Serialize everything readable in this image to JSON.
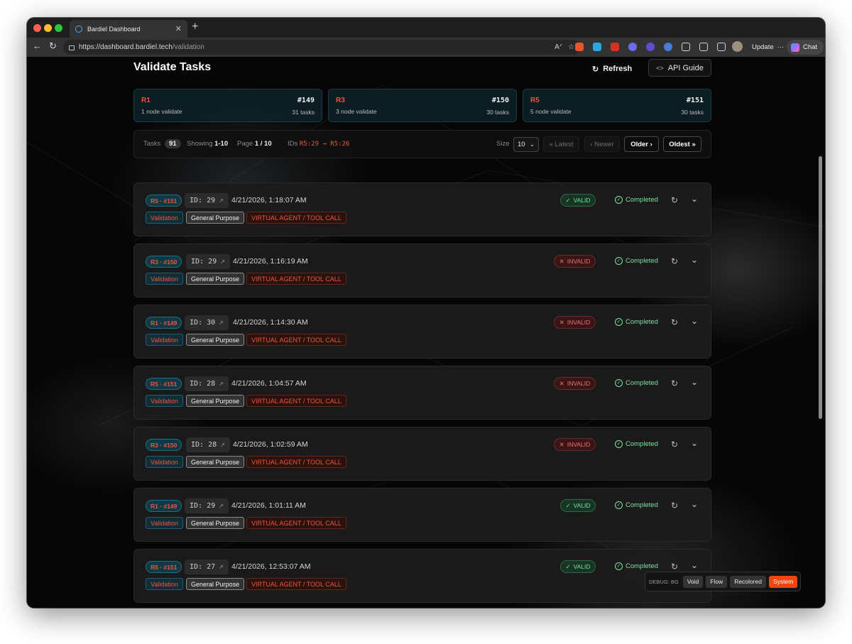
{
  "browser": {
    "tab_title": "Bardiel Dashboard",
    "url_host": "https://dashboard.bardiel.tech",
    "url_path": "/validation",
    "update_label": "Update",
    "chat_label": "Chat"
  },
  "header": {
    "title": "Validate Tasks",
    "refresh_label": "Refresh",
    "api_guide_label": "API Guide"
  },
  "rounds": [
    {
      "name": "R1",
      "number": "#149",
      "desc": "1 node validate",
      "tasks": "31 tasks"
    },
    {
      "name": "R3",
      "number": "#150",
      "desc": "3 node validate",
      "tasks": "30 tasks"
    },
    {
      "name": "R5",
      "number": "#151",
      "desc": "5 node validate",
      "tasks": "30 tasks"
    }
  ],
  "stats": {
    "tasks_label": "Tasks",
    "tasks_count": "91",
    "showing_label": "Showing",
    "showing_value": "1-10",
    "page_label": "Page",
    "page_value": "1 / 10",
    "ids_label": "IDs",
    "ids_value": "R5:29 → R5:26",
    "size_label": "Size",
    "size_value": "10",
    "latest_label": "« Latest",
    "newer_label": "‹ Newer",
    "older_label": "Older ›",
    "oldest_label": "Oldest »"
  },
  "tasks": [
    {
      "round": "R5 · #151",
      "id": "ID: 29",
      "time": "4/21/2026, 1:18:07 AM",
      "result": "VALID",
      "status": "Completed"
    },
    {
      "round": "R3 · #150",
      "id": "ID: 29",
      "time": "4/21/2026, 1:16:19 AM",
      "result": "INVALID",
      "status": "Completed"
    },
    {
      "round": "R1 · #149",
      "id": "ID: 30",
      "time": "4/21/2026, 1:14:30 AM",
      "result": "INVALID",
      "status": "Completed"
    },
    {
      "round": "R5 · #151",
      "id": "ID: 28",
      "time": "4/21/2026, 1:04:57 AM",
      "result": "INVALID",
      "status": "Completed"
    },
    {
      "round": "R3 · #150",
      "id": "ID: 28",
      "time": "4/21/2026, 1:02:59 AM",
      "result": "INVALID",
      "status": "Completed"
    },
    {
      "round": "R1 · #149",
      "id": "ID: 29",
      "time": "4/21/2026, 1:01:11 AM",
      "result": "VALID",
      "status": "Completed"
    },
    {
      "round": "R5 · #151",
      "id": "ID: 27",
      "time": "4/21/2026, 12:53:07 AM",
      "result": "VALID",
      "status": "Completed"
    }
  ],
  "tags": {
    "validation": "Validation",
    "general": "General Purpose",
    "virtual_agent": "VIRTUAL AGENT / TOOL CALL"
  },
  "debug": {
    "label": "DEBUG: BG",
    "options": [
      "Void",
      "Flow",
      "Recolored",
      "System"
    ],
    "active": "System"
  },
  "colors": {
    "accent": "#f0543b",
    "valid": "#6fe39a",
    "invalid": "#f07070",
    "debug_active": "#f2450d"
  },
  "icons": {
    "refresh": "refresh-icon",
    "api_guide": "code-icon",
    "external_link": "external-link-icon",
    "rerun": "rerun-icon",
    "expand": "chevron-down-icon",
    "status": "check-circle-icon"
  }
}
